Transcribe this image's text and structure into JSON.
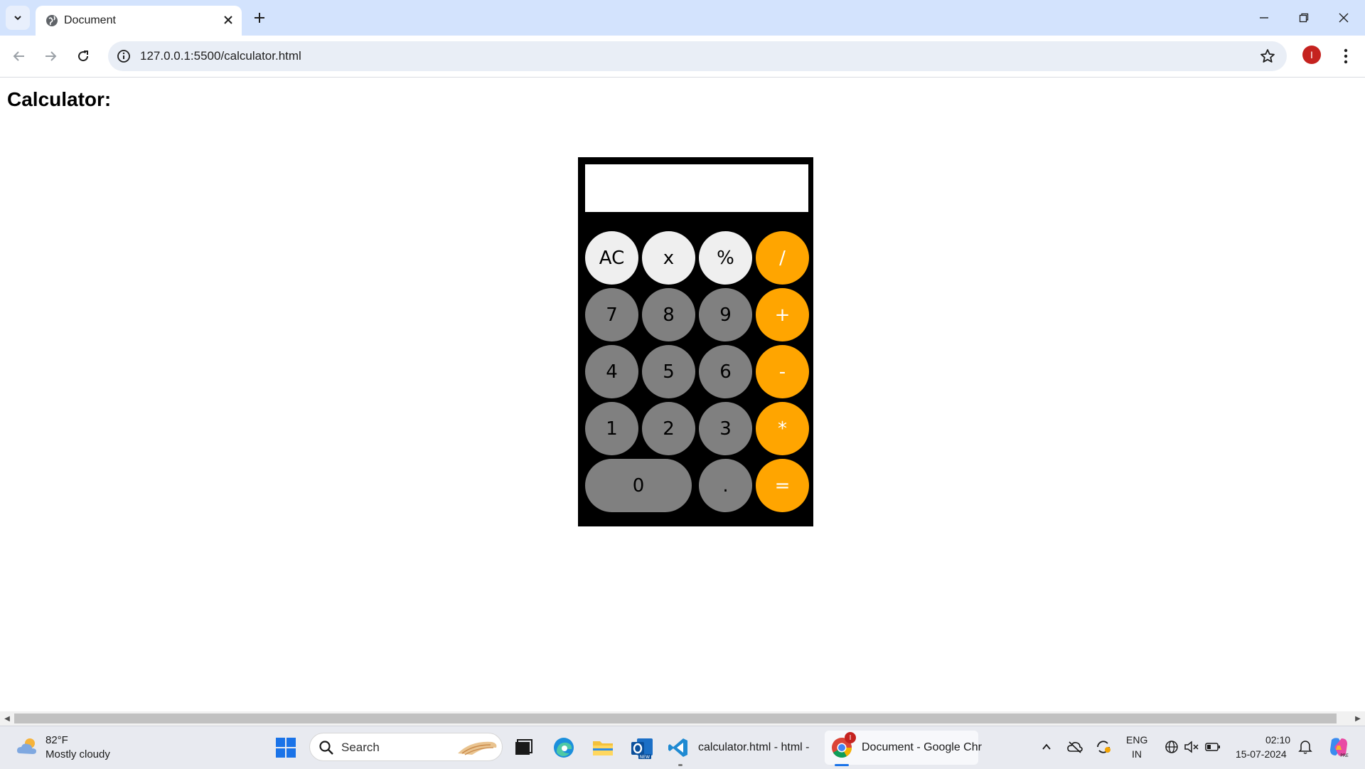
{
  "browser": {
    "tab_title": "Document",
    "url": "127.0.0.1:5500/calculator.html",
    "profile_initial": "I"
  },
  "page": {
    "title": "Calculator:",
    "display_value": ""
  },
  "calculator": {
    "keys": [
      {
        "label": "AC",
        "style": "light"
      },
      {
        "label": "x",
        "style": "light"
      },
      {
        "label": "%",
        "style": "light"
      },
      {
        "label": "/",
        "style": "op"
      },
      {
        "label": "7",
        "style": "dark"
      },
      {
        "label": "8",
        "style": "dark"
      },
      {
        "label": "9",
        "style": "dark"
      },
      {
        "label": "+",
        "style": "op"
      },
      {
        "label": "4",
        "style": "dark"
      },
      {
        "label": "5",
        "style": "dark"
      },
      {
        "label": "6",
        "style": "dark"
      },
      {
        "label": "-",
        "style": "op"
      },
      {
        "label": "1",
        "style": "dark"
      },
      {
        "label": "2",
        "style": "dark"
      },
      {
        "label": "3",
        "style": "dark"
      },
      {
        "label": "*",
        "style": "op"
      },
      {
        "label": "0",
        "style": "dark"
      },
      {
        "label": ".",
        "style": "dark"
      },
      {
        "label": "=",
        "style": "op"
      }
    ],
    "colors": {
      "light": "#efefef",
      "dark": "#808080",
      "op": "#ffa500",
      "body": "#000000"
    }
  },
  "taskbar": {
    "weather_temp": "82°F",
    "weather_desc": "Mostly cloudy",
    "search_placeholder": "Search",
    "vscode_label": "calculator.html - html -",
    "chrome_label": "Document - Google Chr",
    "chrome_badge": "I",
    "lang_top": "ENG",
    "lang_bottom": "IN",
    "time": "02:10",
    "date": "15-07-2024",
    "outlook_badge": "NEW",
    "copilot_badge": "PRE"
  }
}
